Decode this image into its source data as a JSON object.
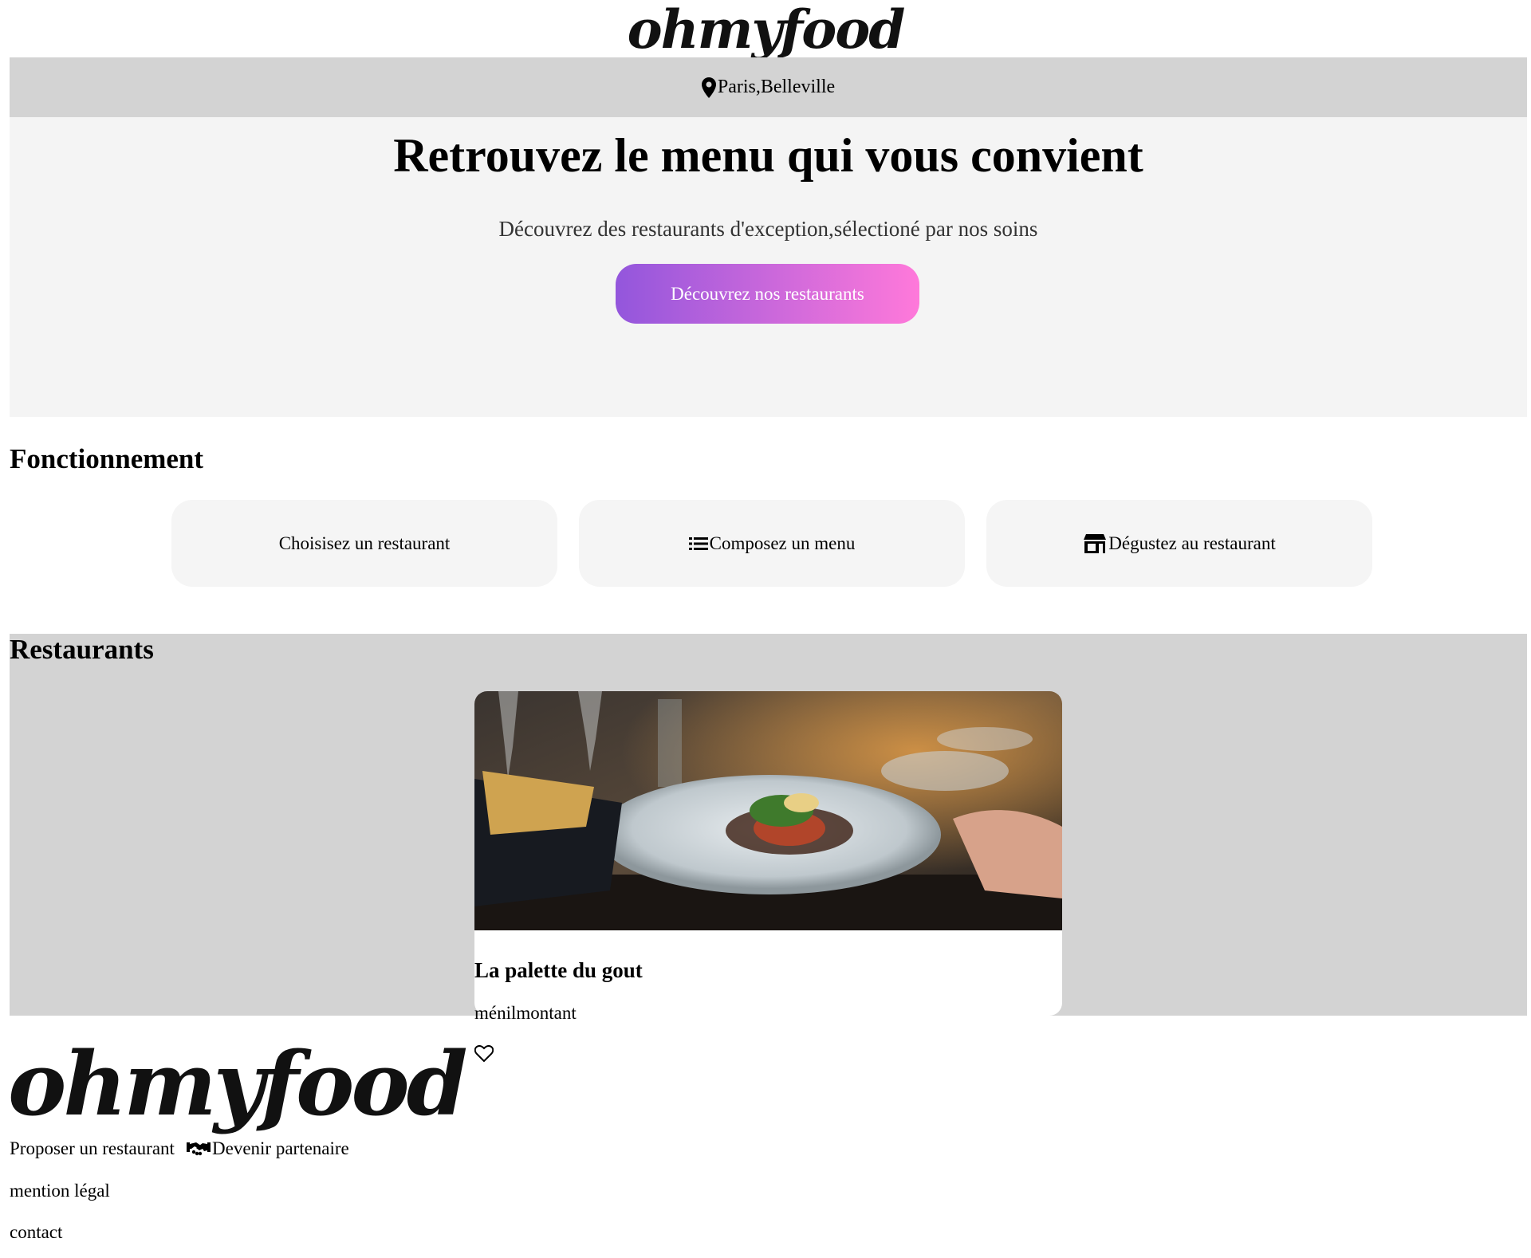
{
  "header": {
    "logo_text": "ohmyfood",
    "location": "Paris,Belleville"
  },
  "hero": {
    "title": "Retrouvez le menu qui vous convient",
    "subtitle": "Découvrez des restaurants d'exception,sélectioné par nos soins",
    "cta_label": "Découvrez nos restaurants",
    "cta_gradient": [
      "#9356dc",
      "#ff79da"
    ]
  },
  "how_it_works": {
    "title": "Fonctionnement",
    "steps": [
      {
        "label": "Choisisez un restaurant",
        "icon": "none"
      },
      {
        "label": "Composez un menu",
        "icon": "list-icon"
      },
      {
        "label": "Dégustez au restaurant",
        "icon": "store-icon"
      }
    ]
  },
  "restaurants": {
    "title": "Restaurants",
    "items": [
      {
        "name": "La palette du gout",
        "area": "ménilmontant",
        "favorite_icon": "heart-outline-icon"
      }
    ]
  },
  "footer": {
    "logo_text": "ohmyfood",
    "links": [
      "Proposer un restaurant",
      "Devenir partenaire",
      "mention légal",
      "contact"
    ],
    "partner_icon": "handshake-icon"
  },
  "colors": {
    "location_bar_bg": "#d3d3d3",
    "hero_bg": "#f4f4f4",
    "card_bg": "#f5f5f5",
    "restaurants_bg": "#d3d3d3"
  }
}
